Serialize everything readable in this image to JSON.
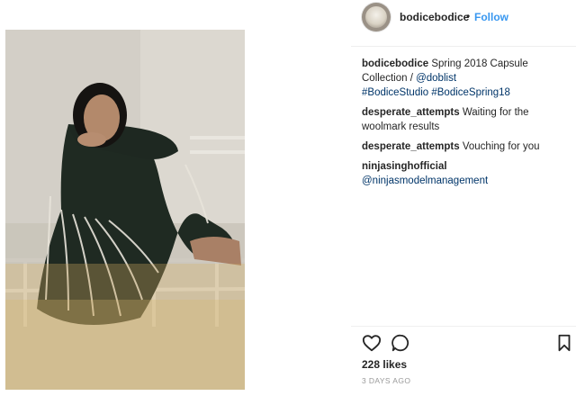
{
  "post": {
    "author": "bodicebodice",
    "follow_separator": "•",
    "follow_label": "Follow",
    "caption": {
      "user": "bodicebodice",
      "text": "Spring 2018 Capsule Collection / ",
      "glyph": "",
      "mention": "@doblist",
      "hashtags": "#BodiceStudio #BodiceSpring18"
    },
    "comments": [
      {
        "user": "desperate_attempts",
        "text": "Waiting for the woolmark results"
      },
      {
        "user": "desperate_attempts",
        "text": "Vouching for you"
      },
      {
        "user": "ninjasinghofficial",
        "text": "",
        "mention": "@ninjasmodelmanagement"
      }
    ],
    "likes": "228 likes",
    "date": "3 DAYS AGO"
  },
  "icons": {
    "like": "heart-icon",
    "comment": "comment-bubble-icon",
    "save": "bookmark-icon"
  },
  "colors": {
    "accent": "#3897f0",
    "link": "#003569",
    "text": "#262626",
    "muted": "#999999"
  }
}
